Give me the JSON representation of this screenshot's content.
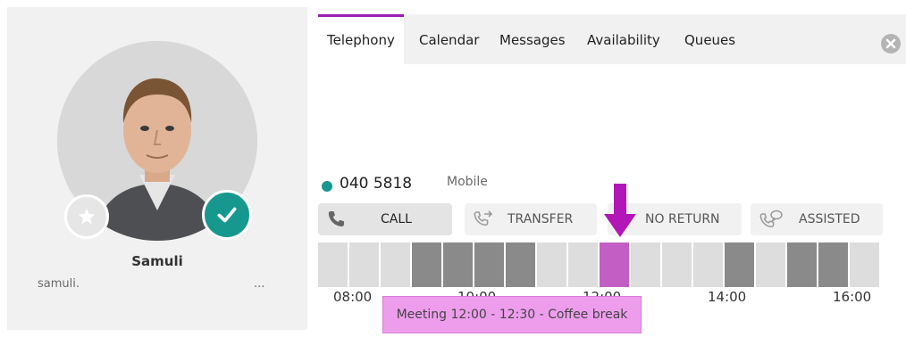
{
  "profile": {
    "name": "Samuli",
    "email": "samuli.",
    "ellipsis": "..."
  },
  "tabs": [
    {
      "label": "Telephony",
      "active": true
    },
    {
      "label": "Calendar",
      "active": false
    },
    {
      "label": "Messages",
      "active": false
    },
    {
      "label": "Availability",
      "active": false
    },
    {
      "label": "Queues",
      "active": false
    }
  ],
  "phone": {
    "number": "040 5818",
    "type": "Mobile",
    "status_color": "#17988f"
  },
  "actions": {
    "call": "CALL",
    "transfer": "TRANSFER",
    "no_return": "NO RETURN",
    "assisted": "ASSISTED"
  },
  "timeline": {
    "slots": [
      "free",
      "free",
      "free",
      "busy",
      "busy",
      "busy",
      "busy",
      "free",
      "free",
      "meeting",
      "free",
      "free",
      "free",
      "busy",
      "free",
      "busy",
      "busy",
      "free"
    ],
    "ticks": [
      "08:00",
      "10:00",
      "12:00",
      "14:00",
      "16:00"
    ]
  },
  "tooltip": "Meeting 12:00 - 12:30 - Coffee break",
  "colors": {
    "accent": "#9a1db3",
    "teal": "#17988f",
    "busy": "#8a8a8a",
    "free": "#dddddd",
    "meeting": "#c25ec4",
    "arrow": "#b316b7"
  }
}
